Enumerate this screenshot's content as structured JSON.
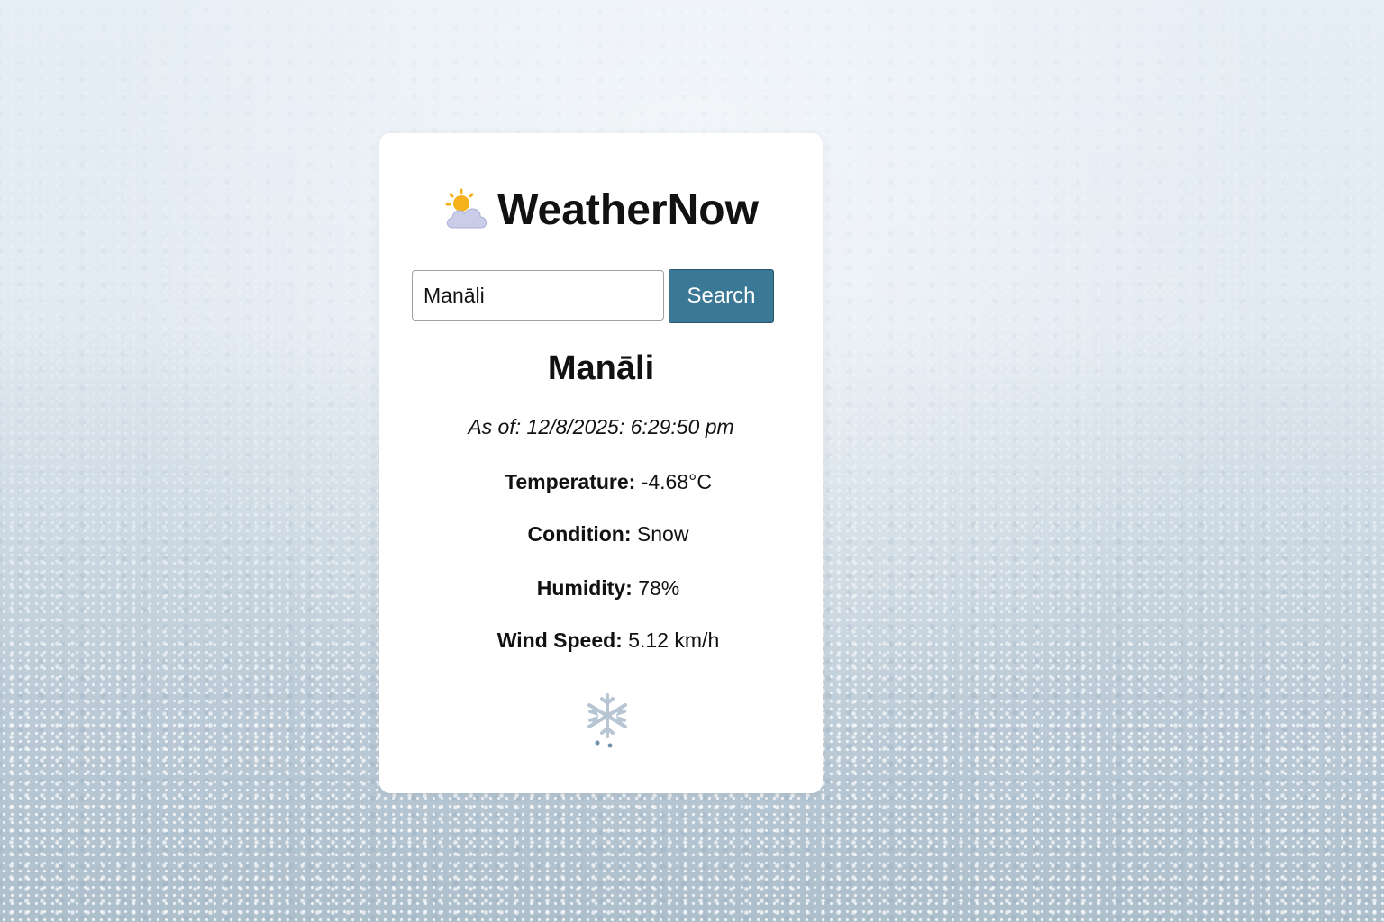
{
  "app": {
    "title": "WeatherNow",
    "logo_icon": "sun-behind-cloud-icon"
  },
  "search": {
    "value": "Manāli",
    "button_label": "Search"
  },
  "weather": {
    "city": "Manāli",
    "as_of": "As of: 12/8/2025: 6:29:50 pm",
    "temperature_label": "Temperature:",
    "temperature_value": "-4.68°C",
    "condition_label": "Condition:",
    "condition_value": "Snow",
    "humidity_label": "Humidity:",
    "humidity_value": "78%",
    "wind_label": "Wind Speed:",
    "wind_value": "5.12 km/h",
    "condition_icon": "snowflake-icon"
  },
  "colors": {
    "button_bg": "#3a7896",
    "card_bg": "#ffffff",
    "text": "#111111"
  }
}
